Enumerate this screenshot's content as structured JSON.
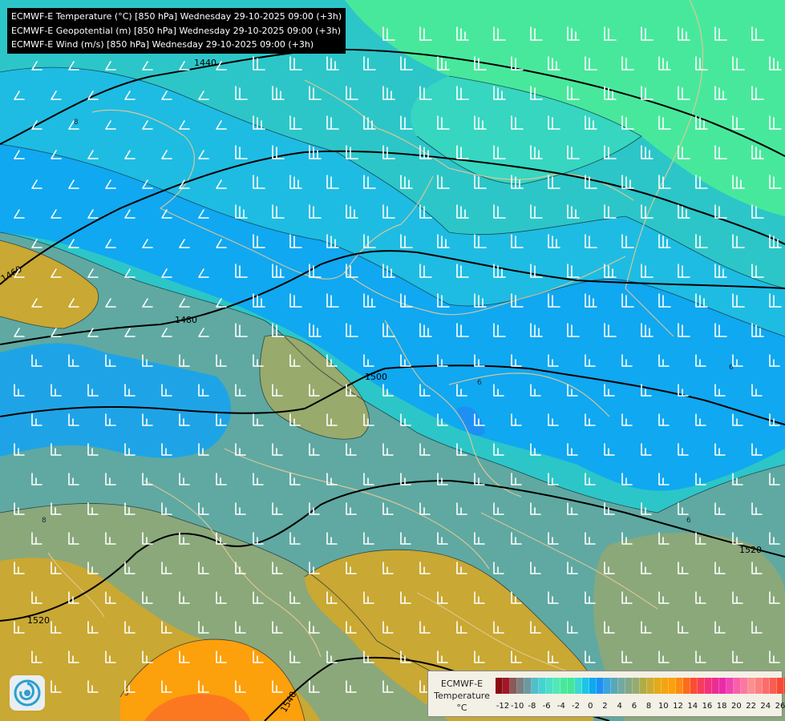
{
  "header": {
    "lines": [
      "ECMWF-E Temperature (°C) [850 hPa] Wednesday 29-10-2025 09:00 (+3h)",
      "ECMWF-E Geopotential (m) [850 hPa] Wednesday 29-10-2025 09:00 (+3h)",
      "ECMWF-E Wind (m/s) [850 hPa] Wednesday 29-10-2025 09:00 (+3h)"
    ]
  },
  "isohypse_labels": [
    "1440",
    "1460",
    "1480",
    "1500",
    "1520",
    "1520",
    "1540"
  ],
  "isotherm_labels": [
    "8",
    "6",
    "8",
    "6",
    "5",
    "6"
  ],
  "legend": {
    "title": "ECMWF-E",
    "subtitle": "Temperature",
    "unit": "°C",
    "ticks": [
      "-12",
      "-10",
      "-8",
      "-6",
      "-4",
      "-2",
      "0",
      "2",
      "4",
      "6",
      "8",
      "10",
      "12",
      "14",
      "16",
      "18",
      "20",
      "22",
      "24",
      "26"
    ],
    "colors": [
      "#8c0a14",
      "#a01828",
      "#8a5a5a",
      "#7a8080",
      "#6a9aa0",
      "#4fc0c8",
      "#46d2d2",
      "#4ae0c8",
      "#52e8b4",
      "#48e89c",
      "#42e896",
      "#3cd8d2",
      "#1ec4e6",
      "#10a8f0",
      "#1e90f4",
      "#3aa4e0",
      "#58a8b4",
      "#72aaa0",
      "#84a884",
      "#98aa6c",
      "#b0ac48",
      "#ccac30",
      "#e4aa18",
      "#f4a410",
      "#fca00c",
      "#fc8c14",
      "#fc6c1c",
      "#fc4c34",
      "#f83c5c",
      "#f4307c",
      "#ec2c94",
      "#e82ca8",
      "#f044b0",
      "#f860a8",
      "#fc78a0",
      "#fc9090",
      "#fc8080",
      "#fc6c6c",
      "#fc5c50",
      "#f44c34",
      "#ec3c24",
      "#e42c14",
      "#dc200c",
      "#d41a08"
    ]
  },
  "colors": {
    "cold": "#10a8f0",
    "cool": "#2cc6c8",
    "mild": "#6aa89a",
    "warm": "#ccac30",
    "warmer": "#fca00c",
    "warmest": "#fc7820",
    "green": "#48e89c",
    "border": "#e6c896",
    "barb": "#ffffff"
  }
}
